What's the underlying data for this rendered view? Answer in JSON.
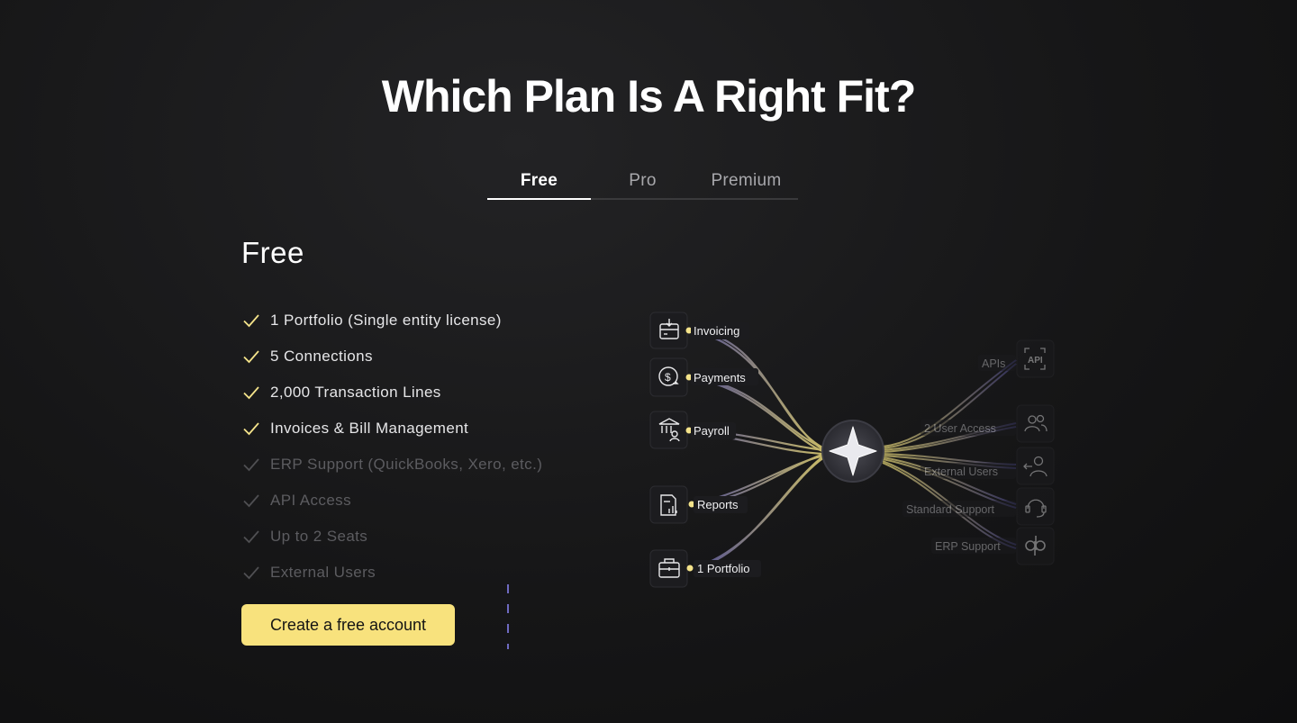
{
  "page": {
    "title": "Which Plan Is A Right Fit?"
  },
  "tabs": [
    {
      "label": "Free",
      "active": true
    },
    {
      "label": "Pro",
      "active": false
    },
    {
      "label": "Premium",
      "active": false
    }
  ],
  "plan": {
    "name": "Free",
    "features": [
      {
        "label": "1 Portfolio (Single entity license)",
        "included": true
      },
      {
        "label": "5 Connections",
        "included": true
      },
      {
        "label": "2,000 Transaction Lines",
        "included": true
      },
      {
        "label": "Invoices & Bill Management",
        "included": true
      },
      {
        "label": "ERP Support (QuickBooks, Xero, etc.)",
        "included": false
      },
      {
        "label": "API Access",
        "included": false
      },
      {
        "label": "Up to 2 Seats",
        "included": false
      },
      {
        "label": "External Users",
        "included": false
      }
    ],
    "cta_label": "Create a free account"
  },
  "diagram": {
    "left_nodes": [
      {
        "label": "Invoicing",
        "icon": "calendar-download-icon"
      },
      {
        "label": "Payments",
        "icon": "dollar-exchange-icon"
      },
      {
        "label": "Payroll",
        "icon": "bank-user-icon"
      },
      {
        "label": "Reports",
        "icon": "report-chart-icon"
      },
      {
        "label": "1 Portfolio",
        "icon": "briefcase-icon"
      }
    ],
    "right_nodes": [
      {
        "label": "APIs",
        "icon": "api-icon"
      },
      {
        "label": "2 User Access",
        "icon": "users-icon"
      },
      {
        "label": "External Users",
        "icon": "user-enter-icon"
      },
      {
        "label": "Standard Support",
        "icon": "headset-icon"
      },
      {
        "label": "ERP Support",
        "icon": "quickbooks-icon"
      }
    ],
    "hub_icon": "sparkle-icon"
  },
  "colors": {
    "accent": "#f8e27d",
    "background": "#161617",
    "line_purple": "#5b59a8"
  }
}
